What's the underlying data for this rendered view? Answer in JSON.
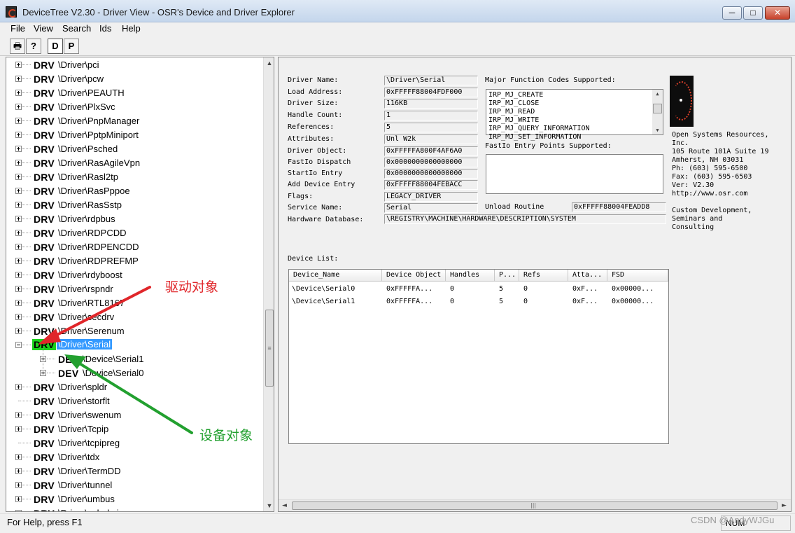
{
  "window": {
    "title": "DeviceTree V2.30 - Driver View - OSR's Device and Driver Explorer",
    "min_glyph": "─",
    "max_glyph": "□",
    "close_glyph": "✕"
  },
  "menu": [
    "File",
    "View",
    "Search",
    "Ids",
    "Help"
  ],
  "toolbar": {
    "print_glyph": "🖶",
    "help_glyph": "?",
    "driver_view_label": "D",
    "plugplay_view_label": "P"
  },
  "tree": {
    "rows": [
      {
        "tag": "DRV",
        "path": "\\Driver\\pci",
        "expandable": true,
        "level": 0
      },
      {
        "tag": "DRV",
        "path": "\\Driver\\pcw",
        "expandable": true,
        "level": 0
      },
      {
        "tag": "DRV",
        "path": "\\Driver\\PEAUTH",
        "expandable": true,
        "level": 0
      },
      {
        "tag": "DRV",
        "path": "\\Driver\\PlxSvc",
        "expandable": true,
        "level": 0
      },
      {
        "tag": "DRV",
        "path": "\\Driver\\PnpManager",
        "expandable": true,
        "level": 0
      },
      {
        "tag": "DRV",
        "path": "\\Driver\\PptpMiniport",
        "expandable": true,
        "level": 0
      },
      {
        "tag": "DRV",
        "path": "\\Driver\\Psched",
        "expandable": true,
        "level": 0
      },
      {
        "tag": "DRV",
        "path": "\\Driver\\RasAgileVpn",
        "expandable": true,
        "level": 0
      },
      {
        "tag": "DRV",
        "path": "\\Driver\\Rasl2tp",
        "expandable": true,
        "level": 0
      },
      {
        "tag": "DRV",
        "path": "\\Driver\\RasPppoe",
        "expandable": true,
        "level": 0
      },
      {
        "tag": "DRV",
        "path": "\\Driver\\RasSstp",
        "expandable": true,
        "level": 0
      },
      {
        "tag": "DRV",
        "path": "\\Driver\\rdpbus",
        "expandable": true,
        "level": 0
      },
      {
        "tag": "DRV",
        "path": "\\Driver\\RDPCDD",
        "expandable": true,
        "level": 0
      },
      {
        "tag": "DRV",
        "path": "\\Driver\\RDPENCDD",
        "expandable": true,
        "level": 0
      },
      {
        "tag": "DRV",
        "path": "\\Driver\\RDPREFMP",
        "expandable": true,
        "level": 0
      },
      {
        "tag": "DRV",
        "path": "\\Driver\\rdyboost",
        "expandable": true,
        "level": 0
      },
      {
        "tag": "DRV",
        "path": "\\Driver\\rspndr",
        "expandable": true,
        "level": 0
      },
      {
        "tag": "DRV",
        "path": "\\Driver\\RTL8167",
        "expandable": true,
        "level": 0
      },
      {
        "tag": "DRV",
        "path": "\\Driver\\secdrv",
        "expandable": true,
        "level": 0
      },
      {
        "tag": "DRV",
        "path": "\\Driver\\Serenum",
        "expandable": true,
        "level": 0
      },
      {
        "tag": "DRV",
        "path": "\\Driver\\Serial",
        "expandable": true,
        "expanded": true,
        "selected": true,
        "level": 0
      },
      {
        "tag": "DEV",
        "path": "\\Device\\Serial1",
        "expandable": true,
        "level": 1
      },
      {
        "tag": "DEV",
        "path": "\\Device\\Serial0",
        "expandable": true,
        "level": 1
      },
      {
        "tag": "DRV",
        "path": "\\Driver\\spldr",
        "expandable": true,
        "level": 0
      },
      {
        "tag": "DRV",
        "path": "\\Driver\\storflt",
        "expandable": false,
        "level": 0
      },
      {
        "tag": "DRV",
        "path": "\\Driver\\swenum",
        "expandable": true,
        "level": 0
      },
      {
        "tag": "DRV",
        "path": "\\Driver\\Tcpip",
        "expandable": true,
        "level": 0
      },
      {
        "tag": "DRV",
        "path": "\\Driver\\tcpipreg",
        "expandable": false,
        "level": 0
      },
      {
        "tag": "DRV",
        "path": "\\Driver\\tdx",
        "expandable": true,
        "level": 0
      },
      {
        "tag": "DRV",
        "path": "\\Driver\\TermDD",
        "expandable": true,
        "level": 0
      },
      {
        "tag": "DRV",
        "path": "\\Driver\\tunnel",
        "expandable": true,
        "level": 0
      },
      {
        "tag": "DRV",
        "path": "\\Driver\\umbus",
        "expandable": true,
        "level": 0
      },
      {
        "tag": "DRV",
        "path": "\\Driver\\usbehci",
        "expandable": true,
        "level": 0
      }
    ],
    "scroll_up": "▲",
    "scroll_down": "▼",
    "scroll_grip": "≡"
  },
  "details": {
    "fields": [
      {
        "label": "Driver Name:",
        "value": "\\Driver\\Serial"
      },
      {
        "label": "Load Address:",
        "value": "0xFFFFF88004FDF000"
      },
      {
        "label": "Driver Size:",
        "value": "116KB"
      },
      {
        "label": "Handle Count:",
        "value": "1"
      },
      {
        "label": "References:",
        "value": "5"
      },
      {
        "label": "Attributes:",
        "value": "Unl W2k"
      },
      {
        "label": "Driver Object:",
        "value": "0xFFFFFA800F4AF6A0"
      },
      {
        "label": "FastIo Dispatch",
        "value": "0x0000000000000000"
      },
      {
        "label": "StartIo Entry",
        "value": "0x0000000000000000"
      },
      {
        "label": "Add Device Entry",
        "value": "0xFFFFF88004FEBACC"
      },
      {
        "label": "Flags:",
        "value": "LEGACY_DRIVER"
      },
      {
        "label": "Service Name:",
        "value": "Serial"
      }
    ],
    "hardware_db_label": "Hardware Database:",
    "hardware_db_value": "\\REGISTRY\\MACHINE\\HARDWARE\\DESCRIPTION\\SYSTEM",
    "unload_label": "Unload Routine",
    "unload_value": "0xFFFFF88004FEADD8",
    "major_label": "Major Function Codes Supported:",
    "major_codes": [
      "IRP_MJ_CREATE",
      "IRP_MJ_CLOSE",
      "IRP_MJ_READ",
      "IRP_MJ_WRITE",
      "IRP_MJ_QUERY_INFORMATION",
      "IRP_MJ_SET_INFORMATION"
    ],
    "fastio_label": "FastIo Entry Points Supported:",
    "osr_info": [
      "Open Systems Resources,",
      "Inc.",
      "105 Route 101A Suite 19",
      "Amherst, NH 03031",
      "Ph:  (603) 595-6500",
      "Fax: (603) 595-6503",
      "Ver: V2.30",
      "http://www.osr.com",
      "",
      "Custom Development,",
      "Seminars and",
      "Consulting"
    ],
    "device_list_label": "Device List:",
    "device_columns": [
      "Device_Name",
      "Device Object",
      "Handles",
      "P...",
      "Refs",
      "Atta...",
      "FSD"
    ],
    "devices": [
      [
        "\\Device\\Serial0",
        "0xFFFFFA...",
        "0",
        "5",
        "0",
        "0xF...",
        "0x00000..."
      ],
      [
        "\\Device\\Serial1",
        "0xFFFFFA...",
        "0",
        "5",
        "0",
        "0xF...",
        "0x00000..."
      ]
    ],
    "hscroll_left": "◄",
    "hscroll_right": "►",
    "hscroll_grip": "|||"
  },
  "status": {
    "help_text": "For Help, press F1",
    "num_indicator": "NUM"
  },
  "annotations": {
    "driver_object": "驱动对象",
    "device_object": "设备对象",
    "red": "#e0262a",
    "green": "#22a02f"
  },
  "watermark": "CSDN @AndyWJGu"
}
